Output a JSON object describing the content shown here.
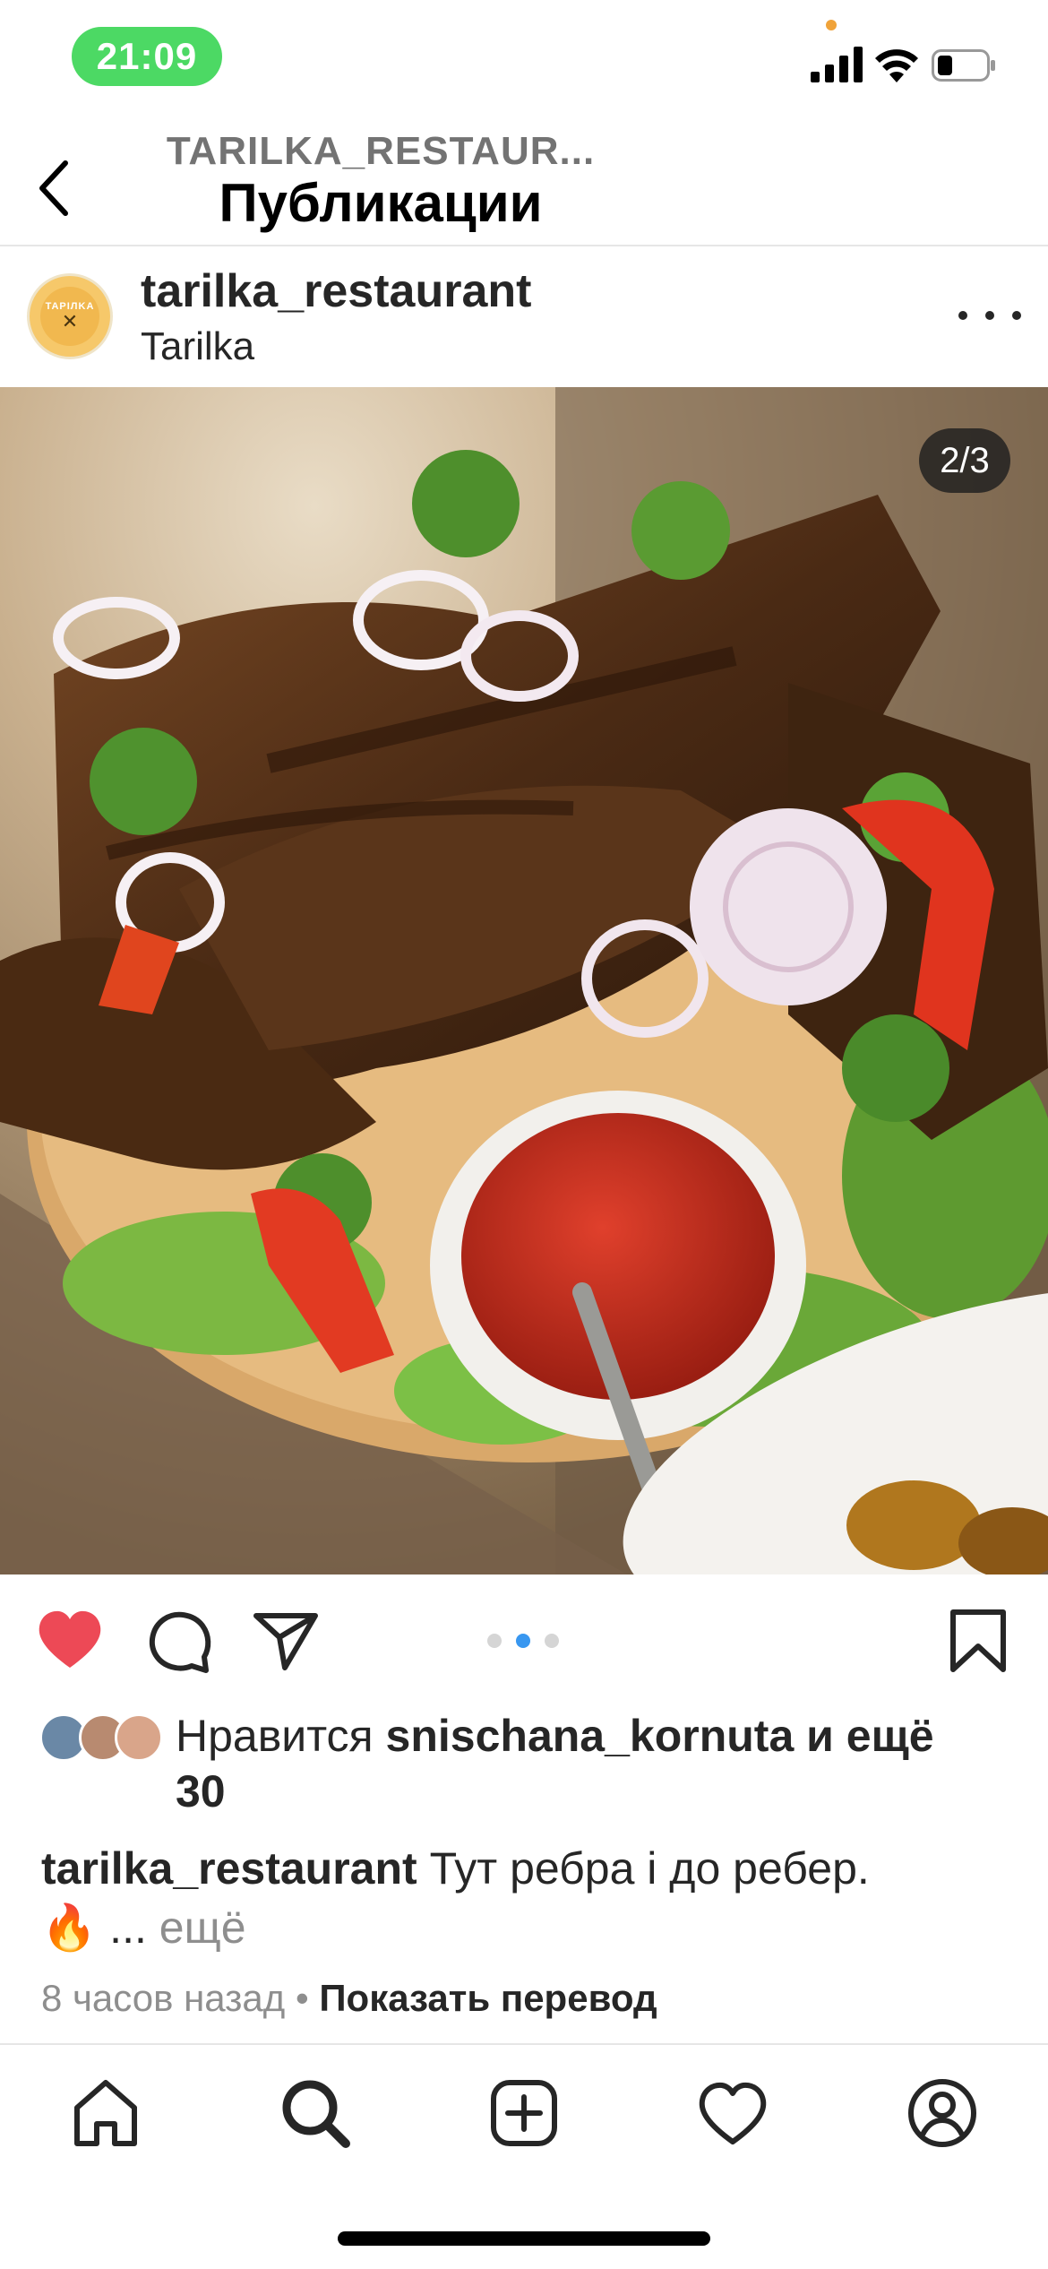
{
  "status_bar": {
    "time": "21:09",
    "icons": [
      "signal-icon",
      "wifi-icon",
      "battery-icon"
    ]
  },
  "header": {
    "account": "TARILKA_RESTAUR...",
    "title": "Публикации",
    "back_icon": "chevron-left-icon"
  },
  "post": {
    "username": "tarilka_restaurant",
    "location": "Tarilka",
    "avatar_text": "TAPIЛKA",
    "image_counter": "2/3",
    "carousel": {
      "count": 3,
      "active": 2
    },
    "liked": true,
    "likes": {
      "prefix": "Нравится",
      "user": "snischana_kornuta",
      "suffix": "и ещё 30"
    },
    "caption": {
      "username": "tarilka_restaurant",
      "text": "Тут ребра і до ребер.",
      "emoji": "🔥",
      "ellipsis": "...",
      "more": "ещё"
    },
    "time_ago": "8 часов назад",
    "separator": "•",
    "translate": "Показать перевод"
  },
  "colors": {
    "like_red": "#ed4956",
    "status_green": "#4cd964",
    "carousel_active": "#3897f0",
    "text_primary": "#262626",
    "text_secondary": "#8e8e8e"
  },
  "tabbar": {
    "items": [
      "home-icon",
      "search-icon",
      "create-icon",
      "activity-icon",
      "profile-icon"
    ]
  }
}
